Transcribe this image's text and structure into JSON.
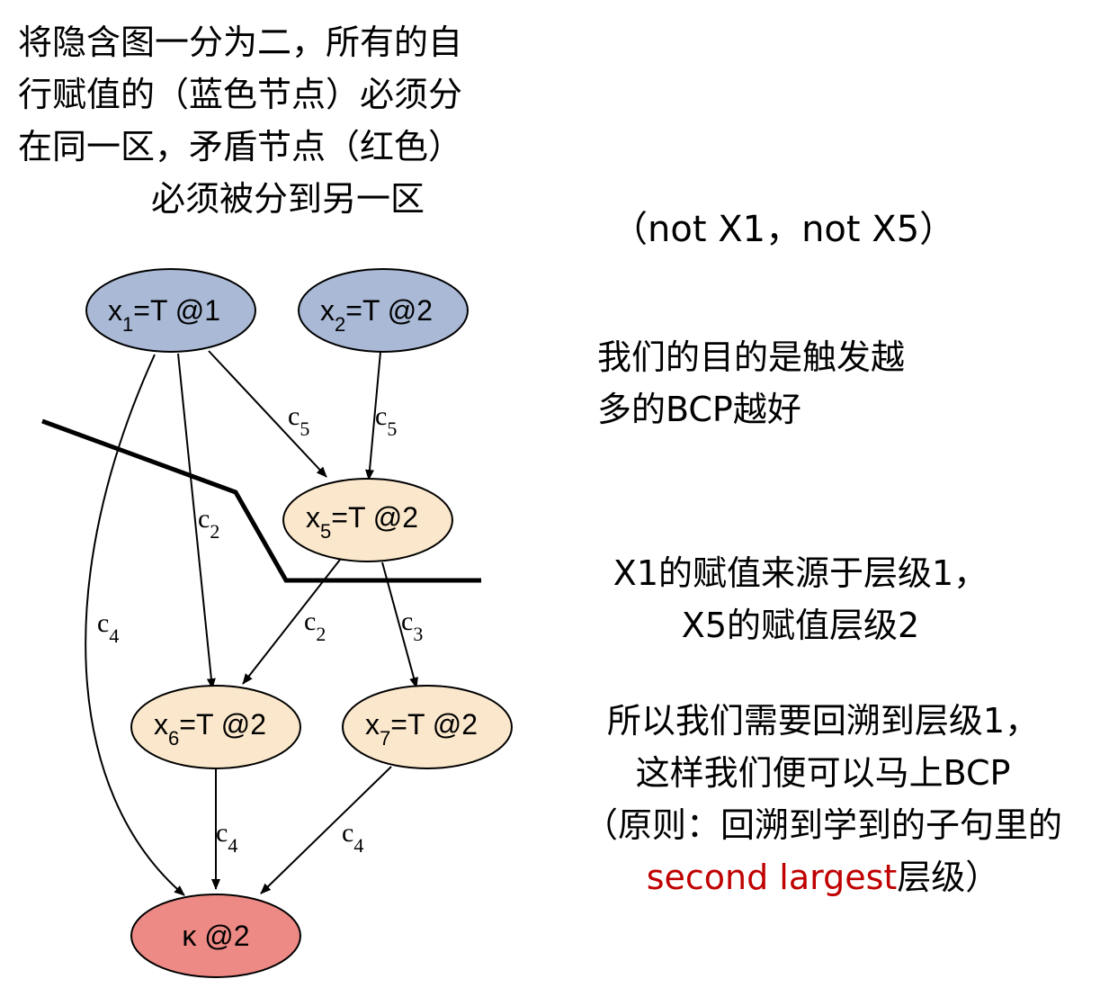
{
  "intro": {
    "line1": "将隐含图一分为二，所有的自",
    "line2": "行赋值的（蓝色节点）必须分",
    "line3": "在同一区，矛盾节点（红色）",
    "line4": "必须被分到另一区"
  },
  "note_not": "（not X1，not X5）",
  "goal": {
    "line1": "我们的目的是触发越",
    "line2": "多的BCP越好"
  },
  "levels": {
    "line1": "X1的赋值来源于层级1，",
    "line2": "X5的赋值层级2"
  },
  "backtrack": {
    "line1": "所以我们需要回溯到层级1，",
    "line2": "这样我们便可以马上BCP",
    "line3a": "（原则：回溯到学到的子句里的",
    "line4_red": "second largest",
    "line4_rest": "层级）"
  },
  "colors": {
    "decision_node": "#a9b9d6",
    "implied_node": "#fbe8cc",
    "conflict_node": "#ee8a85",
    "highlight_text": "#c00000"
  },
  "graph": {
    "nodes": {
      "x1": {
        "var": "x",
        "sub": "1",
        "rest": "=T @1"
      },
      "x2": {
        "var": "x",
        "sub": "2",
        "rest": "=T @2"
      },
      "x5": {
        "var": "x",
        "sub": "5",
        "rest": "=T @2"
      },
      "x6": {
        "var": "x",
        "sub": "6",
        "rest": "=T @2"
      },
      "x7": {
        "var": "x",
        "sub": "7",
        "rest": "=T @2"
      },
      "kappa": {
        "label": "κ @2"
      }
    },
    "edges": {
      "x1_x5": {
        "c": "c",
        "sub": "5"
      },
      "x2_x5": {
        "c": "c",
        "sub": "5"
      },
      "x1_x6": {
        "c": "c",
        "sub": "2"
      },
      "x1_k": {
        "c": "c",
        "sub": "4"
      },
      "x5_x6": {
        "c": "c",
        "sub": "2"
      },
      "x5_x7": {
        "c": "c",
        "sub": "3"
      },
      "x6_k": {
        "c": "c",
        "sub": "4"
      },
      "x7_k": {
        "c": "c",
        "sub": "4"
      }
    }
  }
}
